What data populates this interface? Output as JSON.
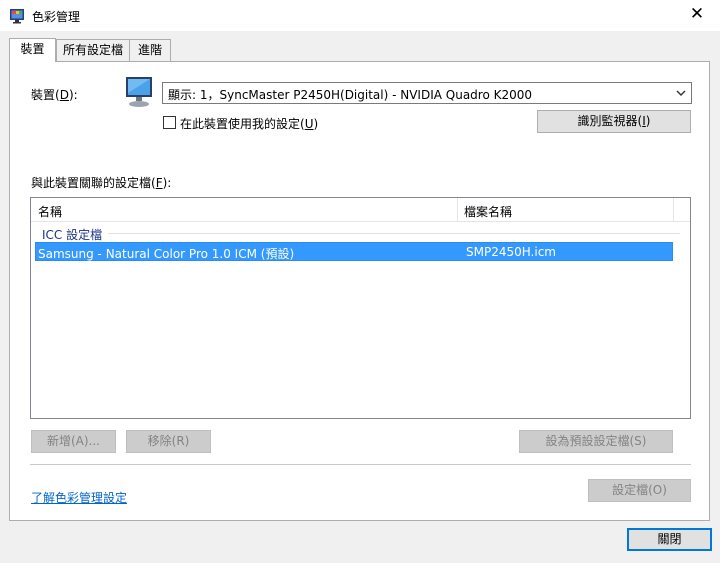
{
  "window": {
    "title": "色彩管理",
    "close_glyph": "✕"
  },
  "tabs": [
    {
      "label": "裝置",
      "active": true
    },
    {
      "label": "所有設定檔",
      "active": false
    },
    {
      "label": "進階",
      "active": false
    }
  ],
  "device": {
    "label_prefix": "裝置(",
    "label_key": "D",
    "label_suffix": "):",
    "selected": "顯示: 1，SyncMaster P2450H(Digital) - NVIDIA Quadro K2000",
    "use_my_settings_label": "在此裝置使用我的設定(",
    "use_my_settings_key": "U",
    "use_my_settings_suffix": ")",
    "use_my_settings_checked": false,
    "identify_label": "識別監視器(",
    "identify_key": "I",
    "identify_suffix": ")"
  },
  "profiles": {
    "label": "與此裝置關聯的設定檔(",
    "label_key": "F",
    "label_suffix": "):",
    "columns": [
      "名稱",
      "檔案名稱"
    ],
    "group": "ICC 設定檔",
    "rows": [
      {
        "name": "Samsung - Natural Color Pro 1.0 ICM (預設)",
        "file": "SMP2450H.icm",
        "selected": true
      }
    ]
  },
  "buttons": {
    "add": "新增(A)...",
    "remove": "移除(R)",
    "set_default": "設為預設設定檔(S)",
    "profiles": "設定檔(O)",
    "close": "關閉"
  },
  "link": {
    "learn_more": "了解色彩管理設定"
  },
  "colors": {
    "selection": "#3399ff",
    "link": "#0066cc",
    "focus_border": "#0078d7"
  }
}
